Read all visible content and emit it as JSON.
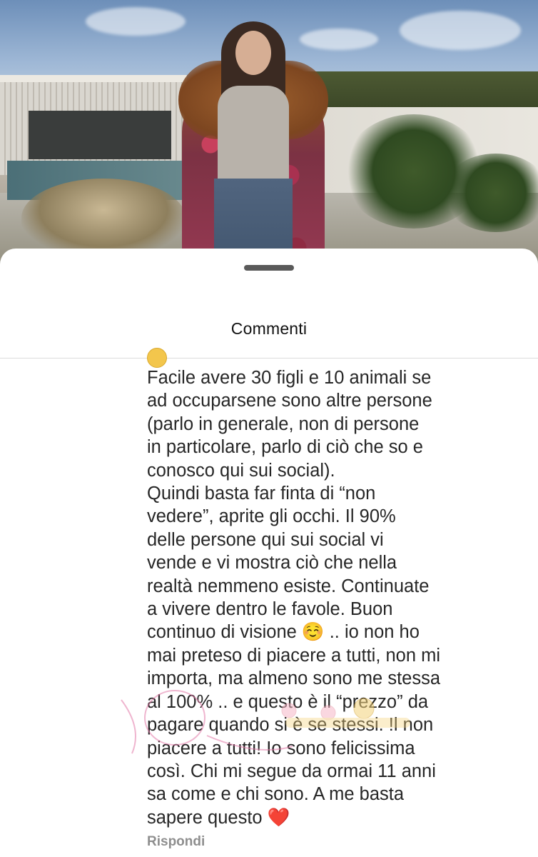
{
  "sheet": {
    "title": "Commenti",
    "comment_text": "Facile avere 30 figli e 10 animali se\nad occuparsene sono altre persone\n(parlo in generale, non di persone\nin particolare, parlo di ciò che so e\nconosco qui sui social).\nQuindi basta far finta di “non\nvedere”, aprite gli occhi. Il 90%\ndelle persone qui sui social vi\nvende e vi mostra ciò che nella\nrealtà nemmeno esiste. Continuate\na vivere dentro le favole. Buon\ncontinuo di visione ☺️ .. io non ho\nmai preteso di piacere a tutti, non mi\nimporta, ma almeno sono me stessa\nal 100% .. e questo è il “prezzo” da\npagare quando si è se stessi. !l non\npiacere a tutti! Io sono felicissima\ncosì. Chi mi segue da ormai 11 anni\nsa come e chi sono. A me basta\nsapere questo ❤️",
    "reply_label": "Rispondi"
  },
  "icons": {
    "drag_handle": "drag-handle-icon",
    "emoji": "smiling-face-icon"
  }
}
